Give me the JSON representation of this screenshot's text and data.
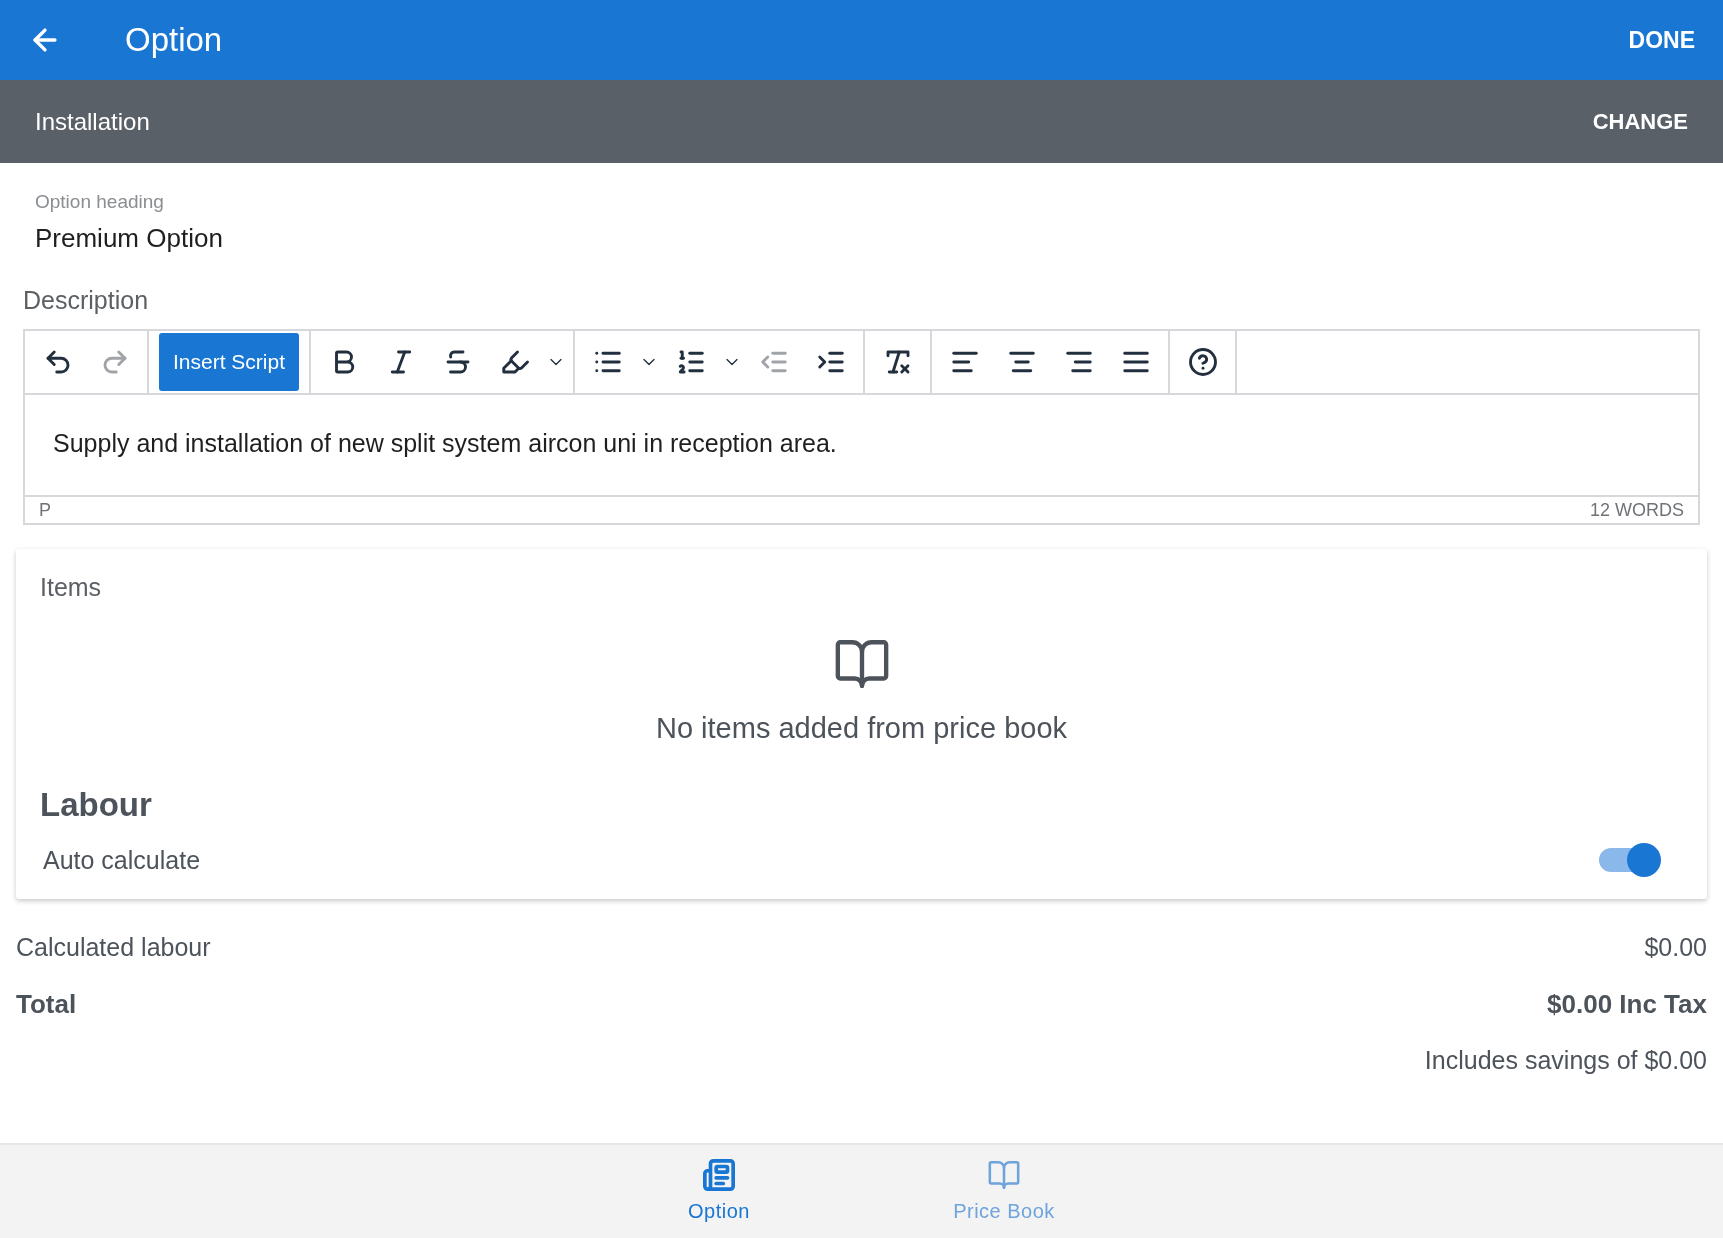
{
  "app_bar": {
    "title": "Option",
    "action": "DONE"
  },
  "sub_bar": {
    "title": "Installation",
    "action": "CHANGE"
  },
  "heading_field": {
    "label": "Option heading",
    "value": "Premium Option"
  },
  "description": {
    "label": "Description",
    "toolbar": [
      [
        {
          "kind": "undo",
          "disabled": false
        },
        {
          "kind": "redo",
          "disabled": true
        }
      ],
      [
        {
          "kind": "script",
          "label": "Insert Script",
          "disabled": false
        }
      ],
      [
        {
          "kind": "bold",
          "disabled": false
        },
        {
          "kind": "italic",
          "disabled": false
        },
        {
          "kind": "strike",
          "disabled": false
        },
        {
          "kind": "highlight",
          "disabled": false
        },
        {
          "kind": "caret",
          "disabled": false
        }
      ],
      [
        {
          "kind": "bullets",
          "disabled": false
        },
        {
          "kind": "caret",
          "disabled": false
        },
        {
          "kind": "numbers",
          "disabled": false
        },
        {
          "kind": "caret",
          "disabled": false
        },
        {
          "kind": "outdent",
          "disabled": true
        },
        {
          "kind": "indent",
          "disabled": false
        }
      ],
      [
        {
          "kind": "clear",
          "disabled": false
        }
      ],
      [
        {
          "kind": "left",
          "disabled": false
        },
        {
          "kind": "center",
          "disabled": false
        },
        {
          "kind": "right",
          "disabled": false
        },
        {
          "kind": "justify",
          "disabled": false
        }
      ],
      [
        {
          "kind": "help",
          "disabled": false
        }
      ]
    ],
    "text": "Supply and installation of new split system aircon uni in reception area.",
    "path": "P",
    "word_count": "12 WORDS"
  },
  "items_card": {
    "title": "Items",
    "empty_message": "No items added from price book",
    "labour_title": "Labour",
    "auto_calculate": {
      "label": "Auto calculate",
      "on": true
    }
  },
  "summary": {
    "calculated_labour": {
      "label": "Calculated labour",
      "value": "$0.00"
    },
    "total": {
      "label": "Total",
      "value": "$0.00 Inc Tax"
    },
    "savings": "Includes savings of $0.00"
  },
  "bottom_nav": [
    {
      "kind": "option",
      "label": "Option",
      "selected": true
    },
    {
      "kind": "book",
      "label": "Price Book",
      "selected": false
    }
  ]
}
